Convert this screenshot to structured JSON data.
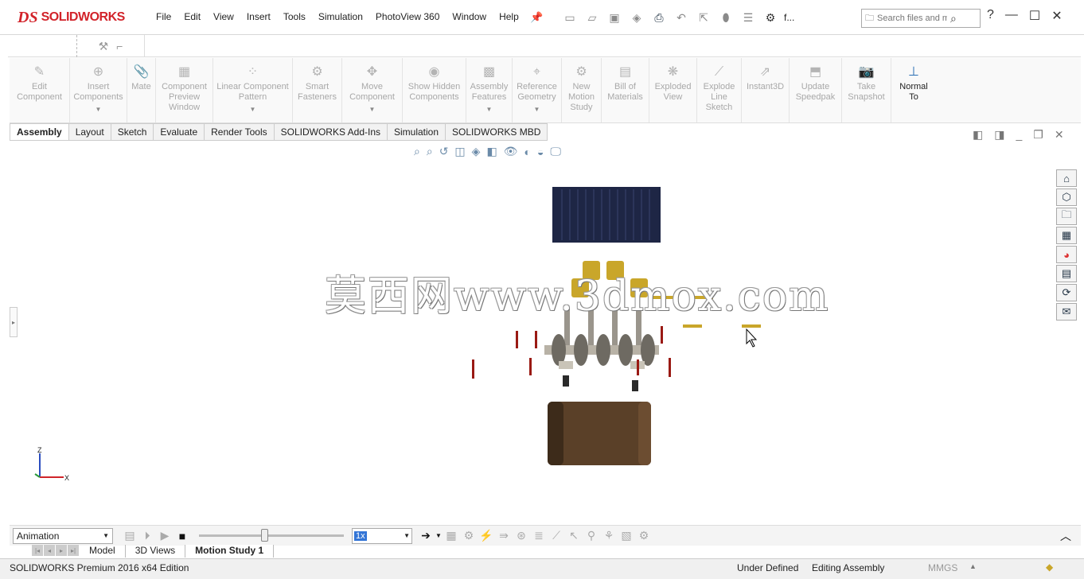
{
  "app": {
    "logo_ds": "DS",
    "logo_name": "SOLIDWORKS"
  },
  "menu": [
    "File",
    "Edit",
    "View",
    "Insert",
    "Tools",
    "Simulation",
    "PhotoView 360",
    "Window",
    "Help"
  ],
  "quick_access": {
    "file_label": "f..."
  },
  "search": {
    "placeholder": "Search files and m"
  },
  "window_buttons": {
    "help": "?",
    "minimize": "—",
    "maximize": "☐",
    "close": "✕"
  },
  "commands": [
    {
      "label": "Edit Component",
      "icon": "edit-component-icon",
      "enabled": false,
      "dropdown": false
    },
    {
      "label": "Insert Components",
      "icon": "insert-components-icon",
      "enabled": false,
      "dropdown": true
    },
    {
      "label": "Mate",
      "icon": "mate-icon",
      "enabled": false,
      "dropdown": false
    },
    {
      "label": "Component Preview Window",
      "icon": "component-preview-icon",
      "enabled": false,
      "dropdown": false
    },
    {
      "label": "Linear Component Pattern",
      "icon": "linear-pattern-icon",
      "enabled": false,
      "dropdown": true
    },
    {
      "label": "Smart Fasteners",
      "icon": "smart-fasteners-icon",
      "enabled": false,
      "dropdown": false
    },
    {
      "label": "Move Component",
      "icon": "move-component-icon",
      "enabled": false,
      "dropdown": true
    },
    {
      "label": "Show Hidden Components",
      "icon": "show-hidden-icon",
      "enabled": false,
      "dropdown": false
    },
    {
      "label": "Assembly Features",
      "icon": "assembly-features-icon",
      "enabled": false,
      "dropdown": true
    },
    {
      "label": "Reference Geometry",
      "icon": "reference-geometry-icon",
      "enabled": false,
      "dropdown": true
    },
    {
      "label": "New Motion Study",
      "icon": "motion-study-icon",
      "enabled": false,
      "dropdown": false
    },
    {
      "label": "Bill of Materials",
      "icon": "bom-icon",
      "enabled": false,
      "dropdown": false
    },
    {
      "label": "Exploded View",
      "icon": "exploded-view-icon",
      "enabled": false,
      "dropdown": false
    },
    {
      "label": "Explode Line Sketch",
      "icon": "explode-line-icon",
      "enabled": false,
      "dropdown": false
    },
    {
      "label": "Instant3D",
      "icon": "instant3d-icon",
      "enabled": false,
      "dropdown": false
    },
    {
      "label": "Update Speedpak",
      "icon": "speedpak-icon",
      "enabled": false,
      "dropdown": false
    },
    {
      "label": "Take Snapshot",
      "icon": "camera-icon",
      "enabled": false,
      "dropdown": false
    },
    {
      "label": "Normal To",
      "icon": "normal-to-icon",
      "enabled": true,
      "dropdown": false
    }
  ],
  "tabs": [
    "Assembly",
    "Layout",
    "Sketch",
    "Evaluate",
    "Render Tools",
    "SOLIDWORKS Add-Ins",
    "Simulation",
    "SOLIDWORKS MBD"
  ],
  "watermark": "莫西网www.3dmox.com",
  "triad": {
    "z": "Z",
    "x": "X"
  },
  "motion_manager": {
    "study_type": "Animation",
    "speed": "1x"
  },
  "bottom_tabs": [
    "Model",
    "3D Views",
    "Motion Study 1"
  ],
  "status": {
    "edition": "SOLIDWORKS Premium 2016 x64 Edition",
    "definition": "Under Defined",
    "mode": "Editing Assembly",
    "units": "MMGS"
  },
  "colors": {
    "brand": "#d2232a",
    "head": "#1e2645",
    "piston": "#c9a62a",
    "block": "#5a4028",
    "crank": "#b8b2a6",
    "rod": "#9a1a14"
  }
}
